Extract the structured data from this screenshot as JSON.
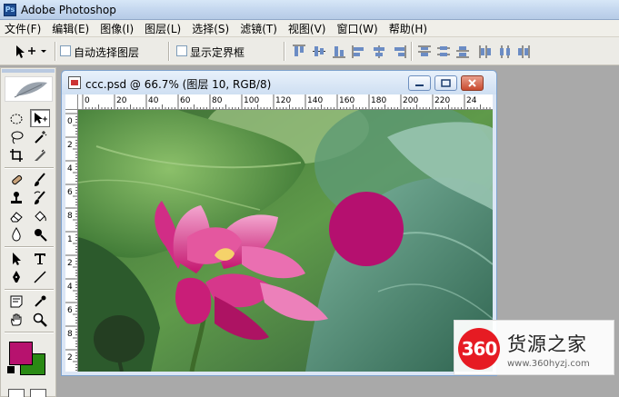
{
  "app": {
    "title": "Adobe Photoshop",
    "icon": "photoshop-app-icon"
  },
  "menu": [
    "文件(F)",
    "编辑(E)",
    "图像(I)",
    "图层(L)",
    "选择(S)",
    "滤镜(T)",
    "视图(V)",
    "窗口(W)",
    "帮助(H)"
  ],
  "options": {
    "auto_select_label": "自动选择图层",
    "auto_select_checked": false,
    "show_bounds_label": "显示定界框",
    "show_bounds_checked": false
  },
  "document": {
    "title": "ccc.psd @ 66.7% (图层 10, RGB/8)",
    "ruler_top_ticks": [
      "0",
      "20",
      "40",
      "60",
      "80",
      "100",
      "120",
      "140",
      "160",
      "180",
      "200",
      "220",
      "24"
    ],
    "ruler_left_ticks": [
      "0",
      "2",
      "4",
      "6",
      "8",
      "1",
      "2",
      "4",
      "6",
      "8",
      "2"
    ]
  },
  "colors": {
    "foreground": "#b7126e",
    "background": "#2a8a14",
    "circle": "#b5106f"
  },
  "watermark": {
    "logo_text": "360",
    "name": "货源之家",
    "url": "www.360hyzj.com"
  }
}
